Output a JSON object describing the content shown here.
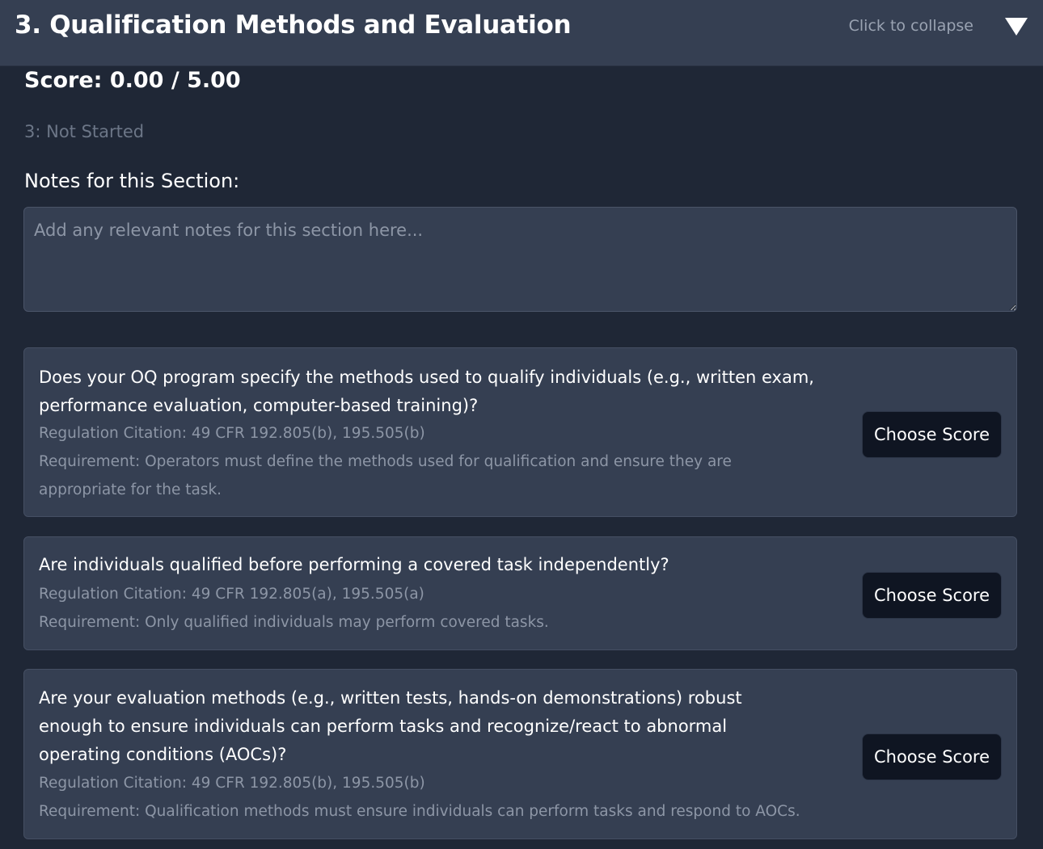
{
  "section": {
    "title": "3. Qualification Methods and Evaluation",
    "collapse_hint": "Click to collapse",
    "collapse_icon": "triangle-down-icon",
    "score": "Score: 0.00 / 5.00",
    "status": "3: Not Started",
    "notes_label": "Notes for this Section:",
    "notes_placeholder": "Add any relevant notes for this section here...",
    "notes_value": ""
  },
  "questions": [
    {
      "text": "Does your OQ program specify the methods used to qualify individuals (e.g., written exam, performance evaluation, computer-based training)?",
      "citation": "Regulation Citation: 49 CFR 192.805(b), 195.505(b)",
      "requirement": "Requirement: Operators must define the methods used for qualification and ensure they are appropriate for the task.",
      "button_label": "Choose Score"
    },
    {
      "text": "Are individuals qualified before performing a covered task independently?",
      "citation": "Regulation Citation: 49 CFR 192.805(a), 195.505(a)",
      "requirement": "Requirement: Only qualified individuals may perform covered tasks.",
      "button_label": "Choose Score"
    },
    {
      "text": "Are your evaluation methods (e.g., written tests, hands-on demonstrations) robust enough to ensure individuals can perform tasks and recognize/react to abnormal operating conditions (AOCs)?",
      "citation": "Regulation Citation: 49 CFR 192.805(b), 195.505(b)",
      "requirement": "Requirement: Qualification methods must ensure individuals can perform tasks and respond to AOCs.",
      "button_label": "Choose Score"
    }
  ]
}
